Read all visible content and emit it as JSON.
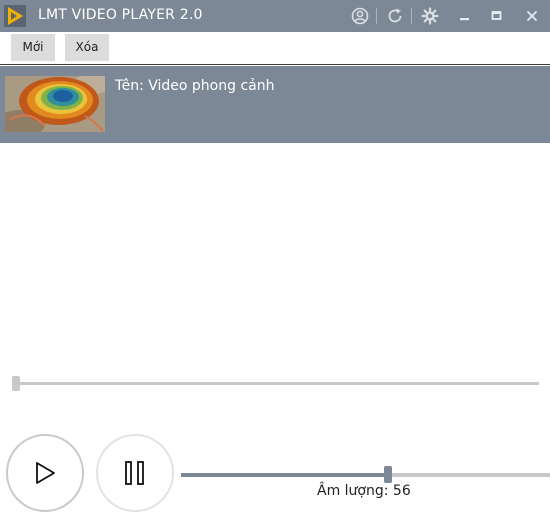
{
  "app": {
    "title": "LMT VIDEO PLAYER 2.0"
  },
  "titlebar": {
    "icons": [
      "user-circle-icon",
      "refresh-icon",
      "gear-icon",
      "minimize-icon",
      "maximize-icon",
      "close-icon"
    ]
  },
  "toolbar": {
    "new_label": "Mới",
    "delete_label": "Xóa"
  },
  "playlist": {
    "items": [
      {
        "name_label": "Tên: Video phong cảnh",
        "thumbnail": "hot-spring-landscape-thumbnail"
      }
    ]
  },
  "player": {
    "seek_position": 0,
    "volume": 56,
    "volume_max": 100,
    "volume_text": "Âm lượng: 56",
    "play_icon": "play-icon",
    "pause_icon": "pause-icon"
  },
  "colors": {
    "accent": "#7c8895",
    "logo": "#f0b400"
  }
}
